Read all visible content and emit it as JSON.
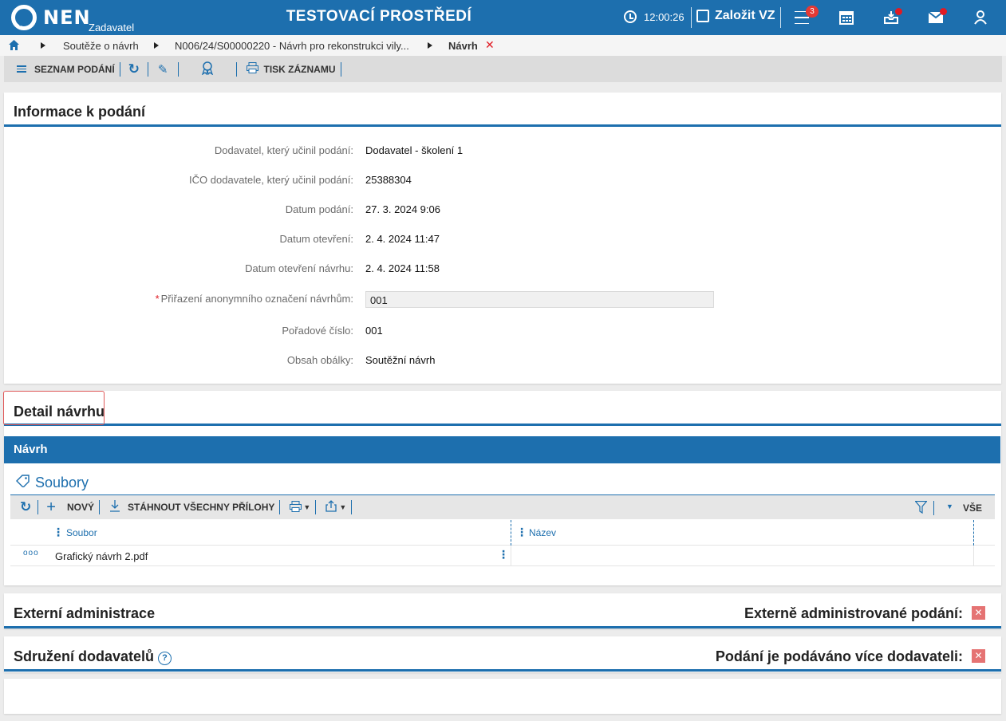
{
  "header": {
    "logo_text": "NEN",
    "logo_sub": "Zadavatel",
    "env_title": "TESTOVACÍ PROSTŘEDÍ",
    "clock": "12:00:26",
    "create_label": "Založit VZ",
    "menu_badge": "3",
    "icons": [
      "clock-icon",
      "edit-icon",
      "menu-icon",
      "calendar-icon",
      "inbox-icon",
      "mail-icon",
      "user-icon"
    ]
  },
  "breadcrumb": {
    "items": [
      "Soutěže o návrh",
      "N006/24/S00000220 - Návrh pro rekonstrukci vily...",
      "Návrh"
    ],
    "close": "✕"
  },
  "toolbar": {
    "list_label": "SEZNAM PODÁNÍ",
    "print_label": "TISK ZÁZNAMU"
  },
  "info": {
    "title": "Informace k podání",
    "rows": [
      {
        "label": "Dodavatel, který učinil podání:",
        "value": "Dodavatel - školení 1"
      },
      {
        "label": "IČO dodavatele, který učinil podání:",
        "value": "25388304"
      },
      {
        "label": "Datum podání:",
        "value": "27. 3. 2024 9:06"
      },
      {
        "label": "Datum otevření:",
        "value": "2. 4. 2024 11:47"
      },
      {
        "label": "Datum otevření návrhu:",
        "value": "2. 4. 2024 11:58"
      },
      {
        "label": "Přiřazení anonymního označení návrhům:",
        "value": "001",
        "required": "*"
      },
      {
        "label": "Pořadové číslo:",
        "value": "001"
      },
      {
        "label": "Obsah obálky:",
        "value": "Soutěžní návrh"
      }
    ]
  },
  "detail": {
    "title": "Detail návrhu",
    "section_bar": "Návrh",
    "files_title": "Soubory",
    "grid_toolbar": {
      "new_label": "NOVÝ",
      "download_label": "STÁHNOUT VŠECHNY PŘÍLOHY",
      "all_label": "VŠE"
    },
    "columns": [
      "Soubor",
      "Název"
    ],
    "rows": [
      {
        "soubor": "Grafický návrh 2.pdf",
        "nazev": ""
      }
    ],
    "row_menu": "ooo"
  },
  "external": {
    "title": "Externí administrace",
    "right_label": "Externě administrované podání:",
    "value": "✕"
  },
  "association": {
    "title": "Sdružení dodavatelů",
    "help": "?",
    "right_label": "Podání je podáváno více dodavateli:",
    "value": "✕"
  },
  "colors": {
    "primary": "#1d6fae",
    "danger": "#e01b24",
    "checkbox_off": "#e57373"
  }
}
